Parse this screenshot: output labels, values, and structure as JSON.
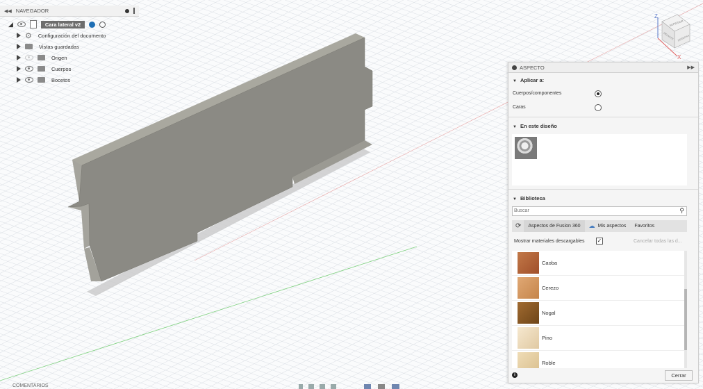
{
  "navigator": {
    "title": "NAVEGADOR",
    "root_label": "Cara lateral v2",
    "items": [
      {
        "label": "Configuración del documento",
        "icon": "gear-icon"
      },
      {
        "label": "Vistas guardadas",
        "icon": "folder-icon"
      },
      {
        "label": "Origen",
        "icon": "folder-icon"
      },
      {
        "label": "Cuerpos",
        "icon": "folder-icon"
      },
      {
        "label": "Bocetos",
        "icon": "folder-icon"
      }
    ]
  },
  "viewcube": {
    "axis_z": "Z",
    "axis_x": "X",
    "face_top": "SUPERIOR",
    "face_front": "DELANTE",
    "face_right": "DERECHA"
  },
  "aspect_panel": {
    "title": "ASPECTO",
    "apply_section": "Aplicar a:",
    "option_bodies": "Cuerpos/componentes",
    "option_faces": "Caras",
    "selected_option": "Cuerpos/componentes",
    "in_design_section": "En este diseño",
    "library_section": "Biblioteca",
    "search_placeholder": "Buscar",
    "tabs": [
      "Aspectos de Fusion 360",
      "Mis aspectos",
      "Favoritos"
    ],
    "show_downloadable": "Mostrar materiales descargables",
    "cancel_all": "Cancelar todas las d...",
    "materials": [
      {
        "name": "Caoba",
        "color": "#b5653c"
      },
      {
        "name": "Cerezo",
        "color": "#d39a62"
      },
      {
        "name": "Nogal",
        "color": "#8a5a23"
      },
      {
        "name": "Pino",
        "color": "#eedcc0"
      },
      {
        "name": "Roble",
        "color": "#e6cfa4"
      }
    ],
    "close_button": "Cerrar"
  },
  "bottom_bar": {
    "comments": "COMENTARIOS"
  },
  "colors": {
    "part": "#8b8a84",
    "part_side": "#a8a7a0",
    "selected_root": "#6d6d6d",
    "accent": "#1f6fb5"
  }
}
